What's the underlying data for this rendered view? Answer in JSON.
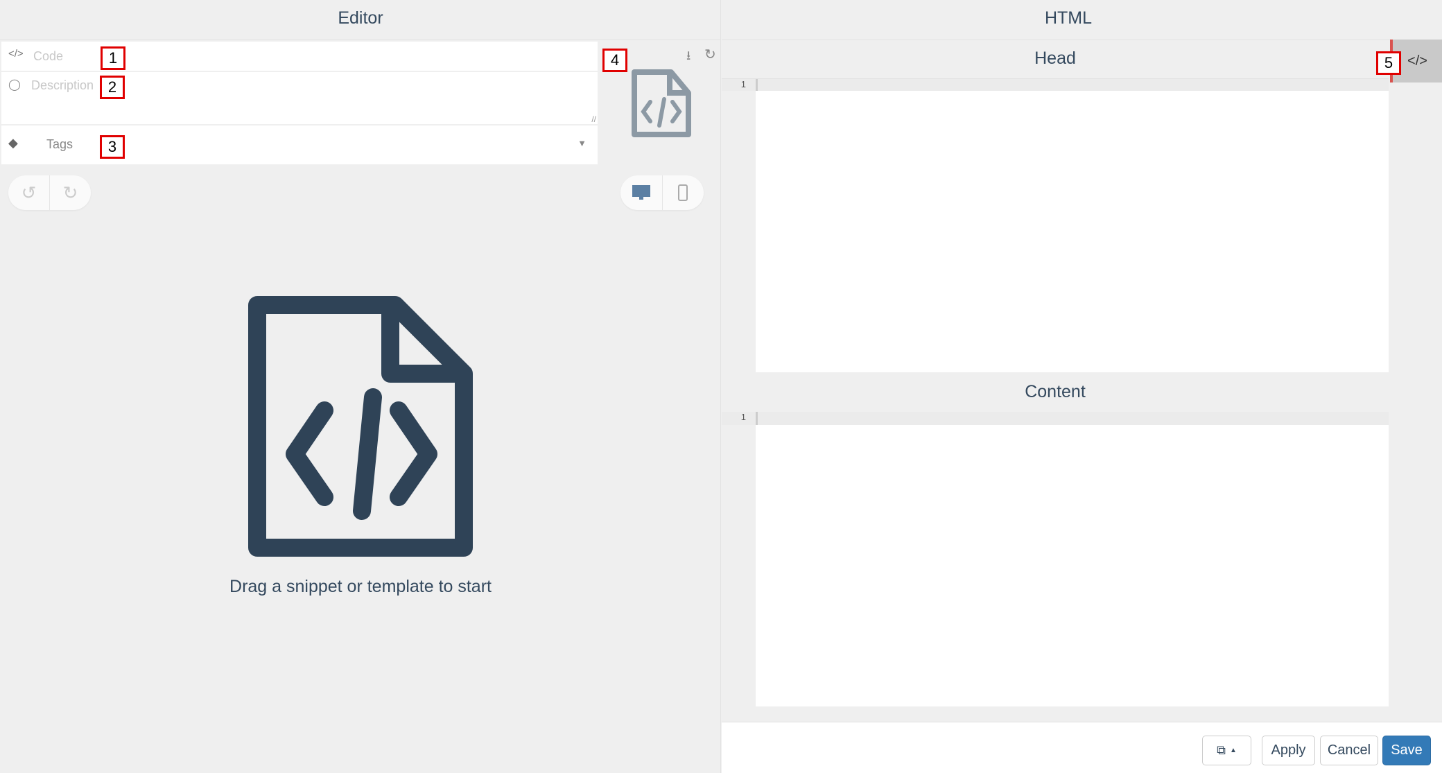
{
  "editor": {
    "title": "Editor",
    "code_placeholder": "Code",
    "description_placeholder": "Description",
    "tags_placeholder": "Tags",
    "empty_message": "Drag a snippet or template to start"
  },
  "html": {
    "title": "HTML",
    "head_title": "Head",
    "content_title": "Content",
    "head_line": "1",
    "content_line": "1"
  },
  "markers": [
    "1",
    "2",
    "3",
    "4",
    "5"
  ],
  "footer": {
    "apply": "Apply",
    "cancel": "Cancel",
    "save": "Save"
  },
  "colors": {
    "primary": "#337ab7",
    "icon": "#2f4357",
    "accent_red": "#d9534f"
  }
}
